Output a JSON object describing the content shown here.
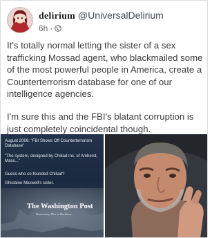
{
  "author": {
    "display_name": "delirium",
    "handle": "@UniversalDelirium",
    "timestamp": "6h",
    "separator": "·",
    "audience_icon": "globe-icon",
    "avatar": "anime-character-avatar"
  },
  "post": {
    "paragraphs": [
      "It's totally normal letting the sister of a sex trafficking Mossad agent, who blackmailed some of the most powerful people in America, create a Counterterrorism database for one of our intelligence agencies.",
      "I'm sure this and the FBI's blatant corruption is just completely coincidental though."
    ]
  },
  "image_left": {
    "lines": [
      "August 2006: \"FBI Shows Off Counterterrorism Database\"",
      "\"The system, designed by Chiliad Inc. of Amherst, Mass...\"",
      "Guess who co-founded Chiliad?",
      "Ghislaine Maxwell's sister."
    ],
    "logo_text": "The Washington Post",
    "logo_tagline": "Democracy Dies in Darkness"
  },
  "image_right": {
    "description_icon": "man-with-hand-on-neck-photo"
  },
  "colors": {
    "text": "#3a3b3c",
    "meta": "#65676b",
    "news_bg": "#1b2a40"
  }
}
